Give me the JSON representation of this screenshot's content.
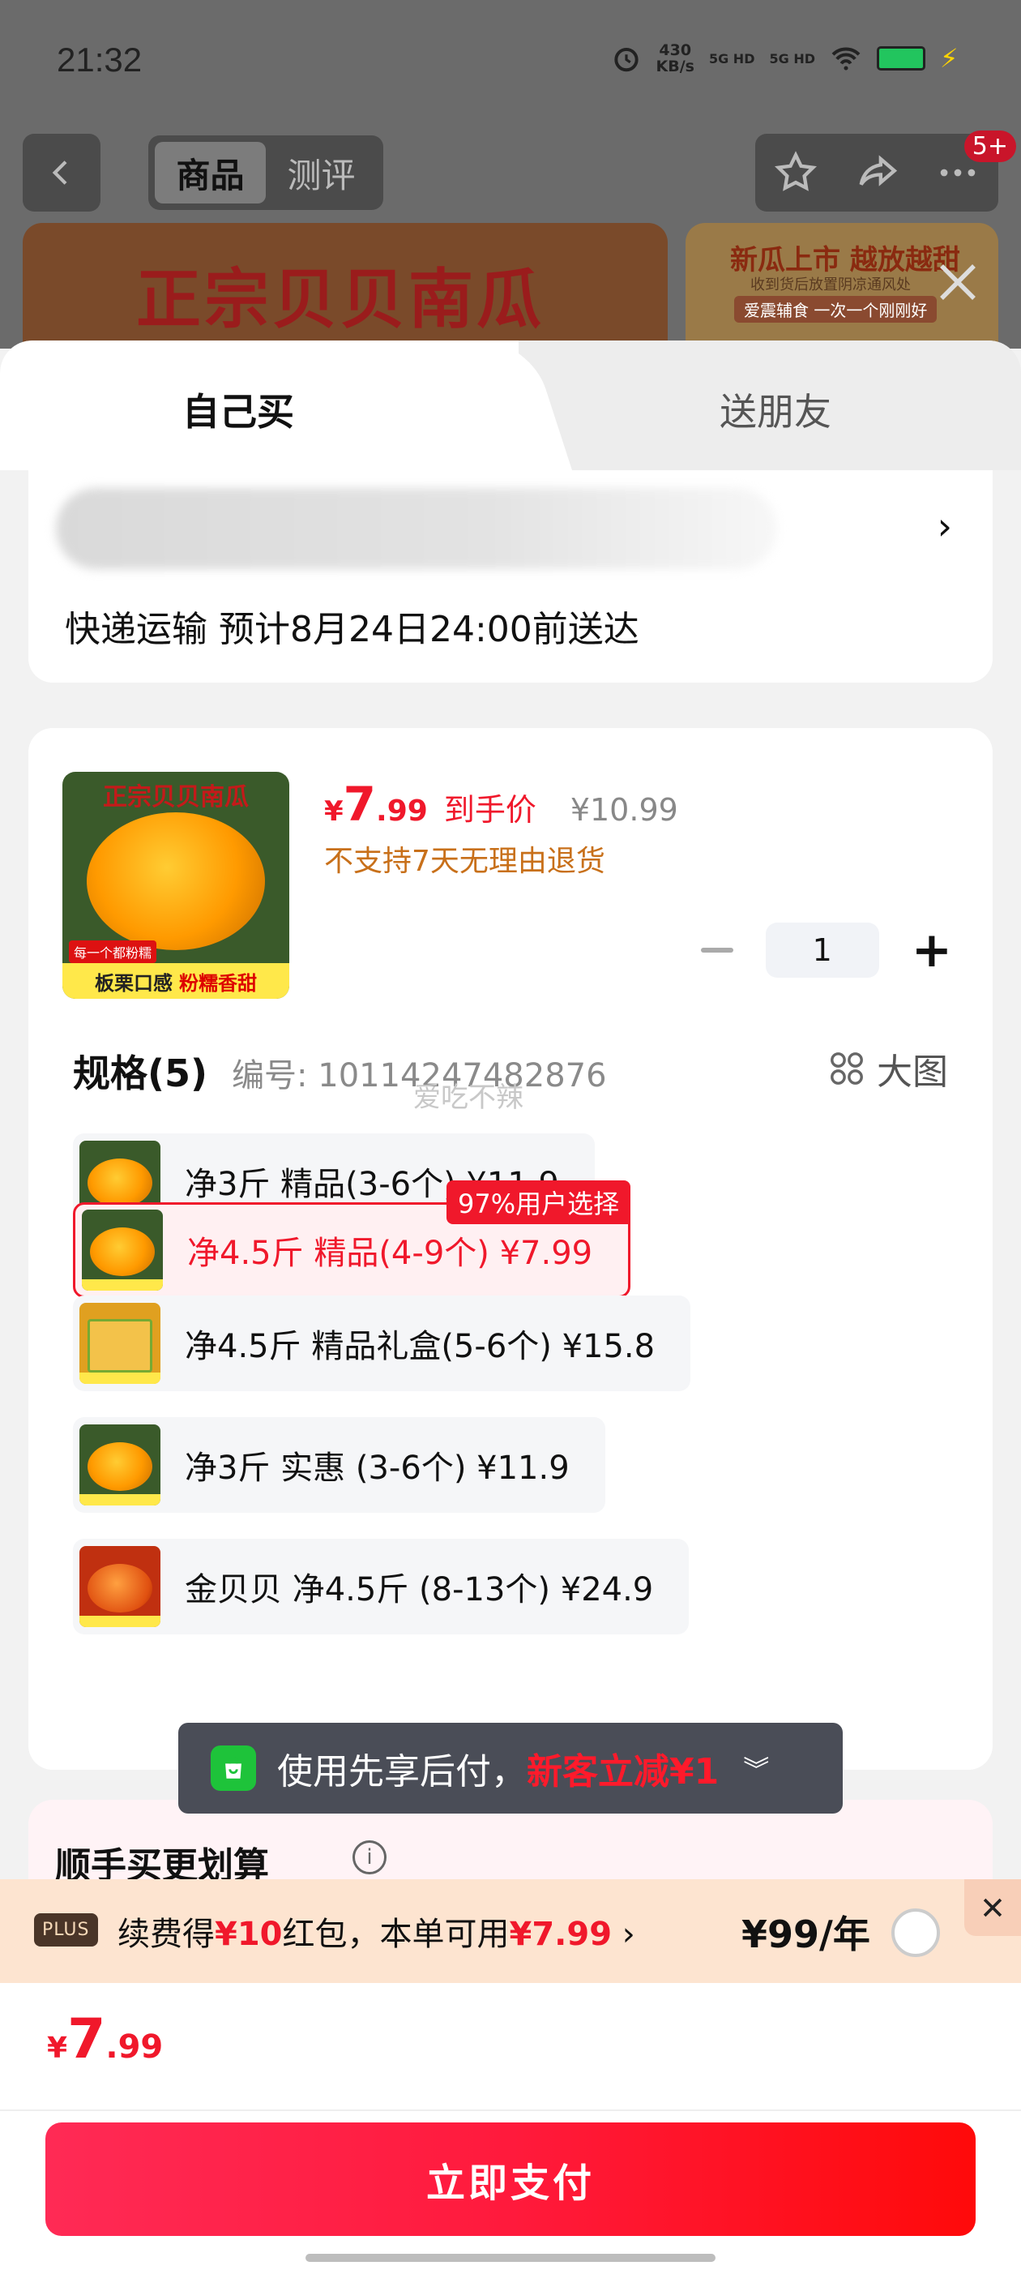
{
  "status_bar": {
    "time": "21:32",
    "net_speed_value": "430",
    "net_speed_unit": "KB/s",
    "sim1": "5G HD",
    "sim2": "5G HD"
  },
  "nav": {
    "tabs": [
      "商品",
      "测评"
    ],
    "badge": "5+"
  },
  "banner": {
    "main_text": "正宗贝贝南瓜",
    "side_line1": "新瓜上市 越放越甜",
    "side_line2": "收到货后放置阴凉通风处",
    "side_line3": "爱震辅食  一次一个刚刚好"
  },
  "sheet_tabs": {
    "self": "自己买",
    "friend": "送朋友"
  },
  "address": {
    "delivery": "快递运输 预计8月24日24:00前送达"
  },
  "product": {
    "thumb_title": "正宗贝贝南瓜",
    "thumb_tag": "每一个都粉糯",
    "thumb_bottom_a": "板栗口感",
    "thumb_bottom_b": "粉糯香甜",
    "price_symbol": "¥",
    "price_int": "7",
    "price_dec": ".99",
    "price_label": "到手价",
    "original_price": "¥10.99",
    "return_policy": "不支持7天无理由退货",
    "quantity": "1"
  },
  "spec": {
    "title": "规格(5)",
    "sku": "编号: 10114247482876",
    "big_pic": "大图",
    "watermark": "爱吃不辣",
    "options": [
      {
        "label": "净3斤 精品(3-6个)  ¥11.9",
        "selected": false
      },
      {
        "label": "净4.5斤 精品(4-9个)  ¥7.99",
        "selected": true,
        "badge": "97%用户选择"
      },
      {
        "label": "净4.5斤 精品礼盒(5-6个)  ¥15.8",
        "selected": false
      },
      {
        "label": "净3斤 实惠 (3-6个)   ¥11.9",
        "selected": false
      },
      {
        "label": "金贝贝 净4.5斤 (8-13个)  ¥24.9",
        "selected": false
      }
    ]
  },
  "tooltip": {
    "text": "使用先享后付，",
    "promo": "新客立减¥1"
  },
  "addon": {
    "title": "顺手买更划算"
  },
  "plus": {
    "tag": "PLUS",
    "text_a": "续费得",
    "text_b": "¥10",
    "text_c": "红包，本单可用",
    "text_d": "¥7.99",
    "text_e": " ›",
    "price": "¥99/年"
  },
  "footer": {
    "symbol": "¥",
    "int": "7",
    "dec": ".99",
    "pay_label": "立即支付"
  },
  "colors": {
    "accent_red": "#f0182b",
    "promo_orange": "#c8701a",
    "tooltip_bg": "#4a4d57",
    "plus_bg": "#fde4d0"
  }
}
